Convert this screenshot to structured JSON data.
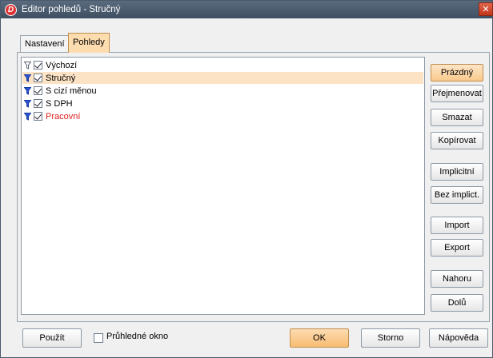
{
  "window": {
    "title": "Editor pohledů - Stručný"
  },
  "tabs": [
    {
      "label": "Nastavení"
    },
    {
      "label": "Pohledy",
      "active": true
    }
  ],
  "views": [
    {
      "label": "Výchozí",
      "checked": true,
      "funnel": "outline",
      "color": "#000000"
    },
    {
      "label": "Stručný",
      "checked": true,
      "funnel": "blue",
      "selected": true,
      "color": "#000000"
    },
    {
      "label": "S cizí měnou",
      "checked": true,
      "funnel": "blue",
      "color": "#000000"
    },
    {
      "label": "S DPH",
      "checked": true,
      "funnel": "blue",
      "color": "#000000"
    },
    {
      "label": "Pracovní",
      "checked": true,
      "funnel": "blue",
      "color": "#e0201e"
    }
  ],
  "side_buttons": {
    "empty": "Prázdný",
    "rename": "Přejmenovat",
    "delete": "Smazat",
    "copy": "Kopírovat",
    "default": "Implicitní",
    "no_default": "Bez implict.",
    "import": "Import",
    "export": "Export",
    "up": "Nahoru",
    "down": "Dolů"
  },
  "bottom": {
    "apply": "Použít",
    "transparent_label": "Průhledné okno",
    "transparent_checked": false,
    "ok": "OK",
    "cancel": "Storno",
    "help": "Nápověda"
  },
  "colors": {
    "accent": "#f8bd72",
    "selection": "#fde3c5",
    "title_bar": "#4a5a6c"
  },
  "icons": {
    "app": "app-logo-icon",
    "close": "close-icon",
    "funnel": "funnel-icon"
  }
}
